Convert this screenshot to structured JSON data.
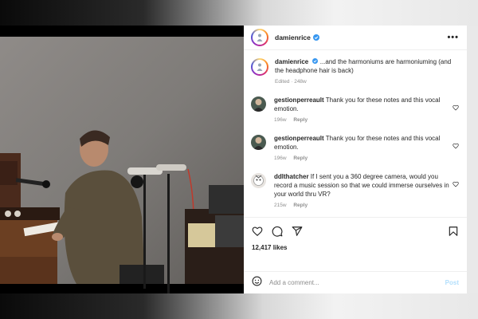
{
  "post": {
    "username": "damienrice",
    "more_label": "•••",
    "caption_text": "...and the harmoniums are harmoniuming (and the headphone hair is back)",
    "caption_meta": "Edited · 248w"
  },
  "comments": [
    {
      "username": "gestionperreault",
      "text": "Thank you for these notes and this vocal emotion.",
      "age": "196w",
      "reply": "Reply"
    },
    {
      "username": "gestionperreault",
      "text": "Thank you for these notes and this vocal emotion.",
      "age": "196w",
      "reply": "Reply"
    },
    {
      "username": "ddlthatcher",
      "text": "If I sent you a 360 degree camera, would you record a music session so that we could immerse ourselves in your world thru VR?",
      "age": "215w",
      "reply": "Reply"
    }
  ],
  "likes": "12,417 likes",
  "add_comment": {
    "placeholder": "Add a comment...",
    "post_label": "Post"
  },
  "icons": {
    "verified": "verified-badge-icon",
    "heart": "heart-icon",
    "comment": "comment-icon",
    "share": "share-icon",
    "save": "bookmark-icon",
    "emoji": "emoji-icon"
  },
  "colors": {
    "verified": "#3897f0",
    "post_disabled": "#b2dffc",
    "muted": "#8e8e8e"
  }
}
